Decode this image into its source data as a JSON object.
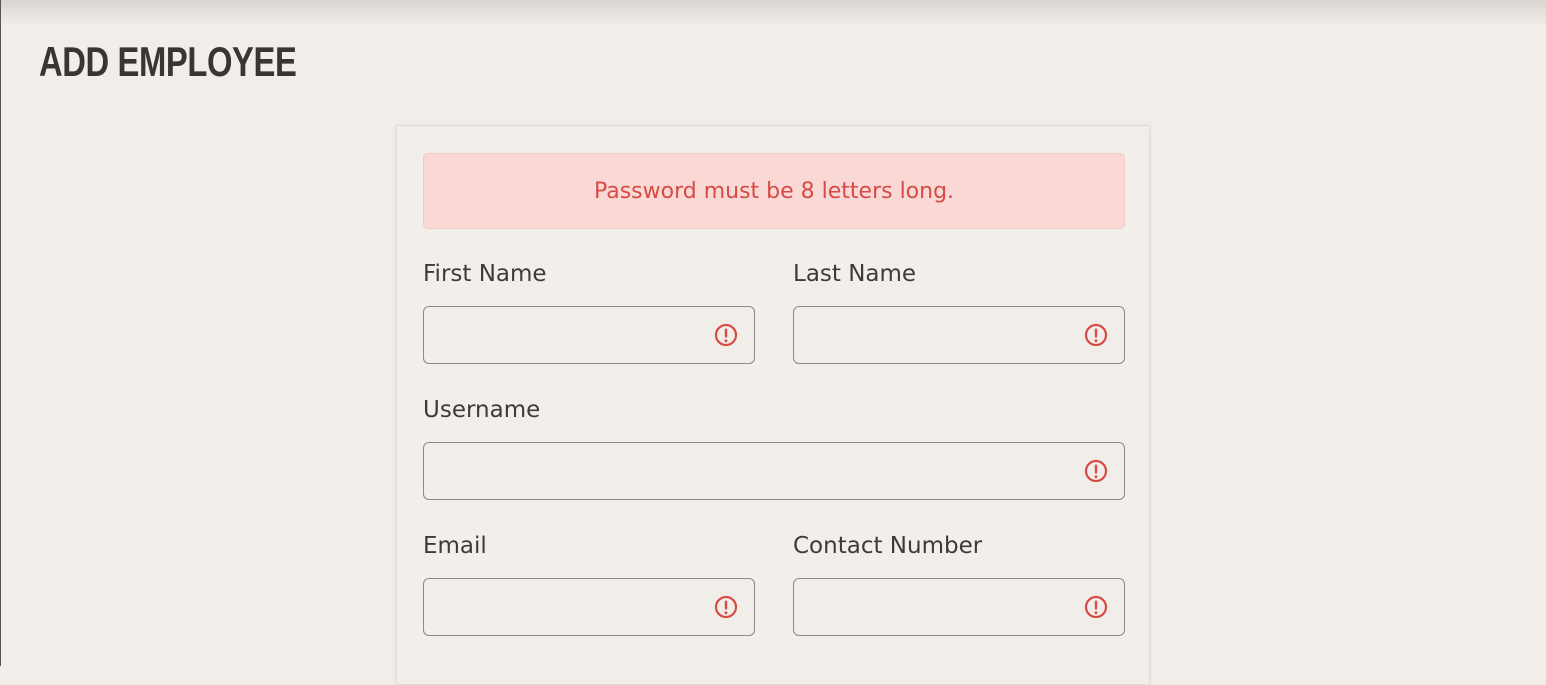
{
  "page": {
    "title": "ADD EMPLOYEE"
  },
  "form": {
    "alert": {
      "message": "Password must be 8 letters long."
    },
    "fields": {
      "first_name": {
        "label": "First Name",
        "value": "",
        "state": "error",
        "icon": "alert-circle-icon"
      },
      "last_name": {
        "label": "Last Name",
        "value": "",
        "state": "error",
        "icon": "alert-circle-icon"
      },
      "username": {
        "label": "Username",
        "value": "",
        "state": "error",
        "icon": "alert-circle-icon"
      },
      "email": {
        "label": "Email",
        "value": "",
        "state": "error",
        "icon": "alert-circle-icon"
      },
      "contact_number": {
        "label": "Contact Number",
        "value": "",
        "state": "error",
        "icon": "alert-circle-icon"
      }
    }
  },
  "colors": {
    "background": "#f1eee9",
    "text": "#3f3a36",
    "error": "#d64b45",
    "alert_background": "#f9d8d5",
    "border": "#8f8883"
  }
}
